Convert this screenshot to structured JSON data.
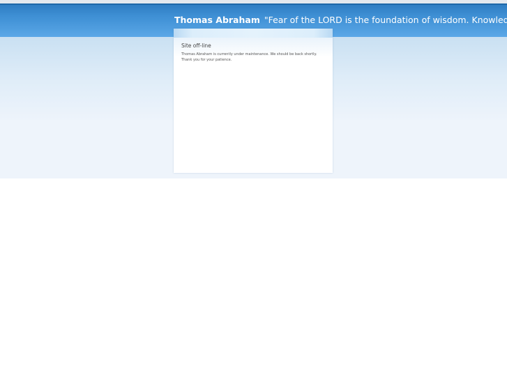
{
  "header": {
    "site_name": "Thomas Abraham",
    "slogan": "\"Fear of the LORD is the foundation of wisdom. Knowledge of the Holy One results in good judgment.\""
  },
  "offline": {
    "title": "Site off-line",
    "message_line_1": "Thomas Abraham is currently under maintenance. We should be back shortly.",
    "message_line_2": "Thank you for your patience."
  },
  "colors": {
    "header_blue": "#3d8ed3",
    "background_light_blue": "#eef4fb",
    "box_white": "#ffffff"
  }
}
